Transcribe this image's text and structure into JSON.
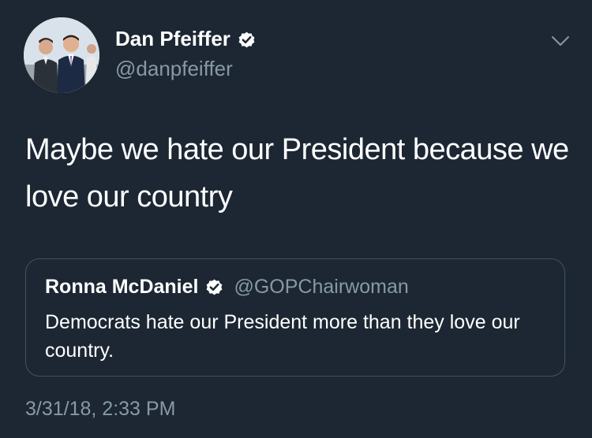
{
  "author": {
    "name": "Dan Pfeiffer",
    "handle": "@danpfeiffer",
    "verified": true
  },
  "tweet": {
    "text": "Maybe we hate our President because we love our country"
  },
  "quoted_tweet": {
    "name": "Ronna McDaniel",
    "handle": "@GOPChairwoman",
    "verified": true,
    "text": "Democrats hate our President more than they love our country."
  },
  "timestamp": "3/31/18, 2:33 PM",
  "icons": {
    "verified": "verified-badge-icon",
    "menu": "chevron-down-icon"
  },
  "colors": {
    "background": "#1c2733",
    "text": "#ffffff",
    "secondary_text": "#8899a6",
    "border": "#3d5466"
  }
}
